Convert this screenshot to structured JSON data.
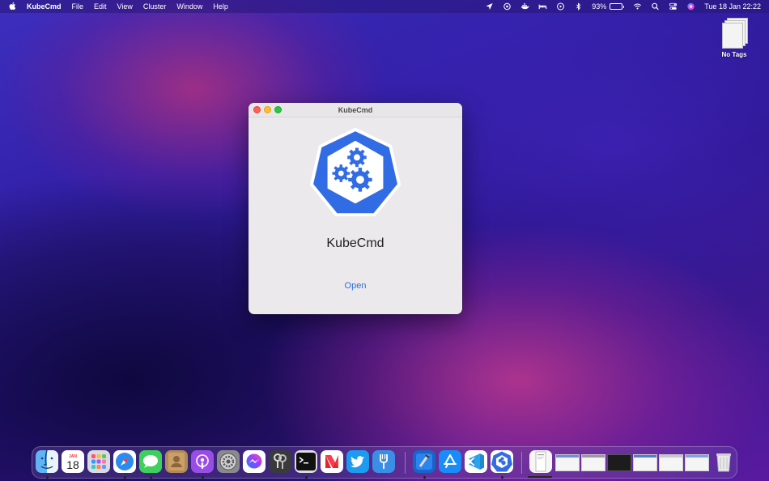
{
  "menubar": {
    "app_name": "KubeCmd",
    "menus": [
      "File",
      "Edit",
      "View",
      "Cluster",
      "Window",
      "Help"
    ],
    "status_icons": [
      "location-icon",
      "kube-status-icon",
      "docker-icon",
      "bed-icon",
      "play-circle-icon",
      "bluetooth-icon"
    ],
    "battery_percent": "93%",
    "battery_level": 0.93,
    "datetime": "Tue 18 Jan  22:22"
  },
  "desktop": {
    "item_label": "No Tags"
  },
  "window": {
    "title": "KubeCmd",
    "app_title": "KubeCmd",
    "open_label": "Open"
  },
  "dock": {
    "calendar_month": "JAN",
    "calendar_day": "18",
    "apps": [
      "finder",
      "calendar",
      "launchpad",
      "safari",
      "messages",
      "contacts",
      "podcasts",
      "system-preferences",
      "messenger",
      "keychain",
      "terminal",
      "news",
      "twitter",
      "fork",
      "xcode-instruments",
      "app-store",
      "vscode",
      "kubecmd"
    ],
    "thumbnails": [
      "document-1",
      "window-1",
      "window-2",
      "window-3",
      "window-4",
      "window-5",
      "window-6"
    ]
  },
  "colors": {
    "accent": "#2f6fd8",
    "kube_blue": "#326ce5",
    "close": "#fe5f57",
    "minimize": "#febc2e",
    "maximize": "#28c840"
  }
}
